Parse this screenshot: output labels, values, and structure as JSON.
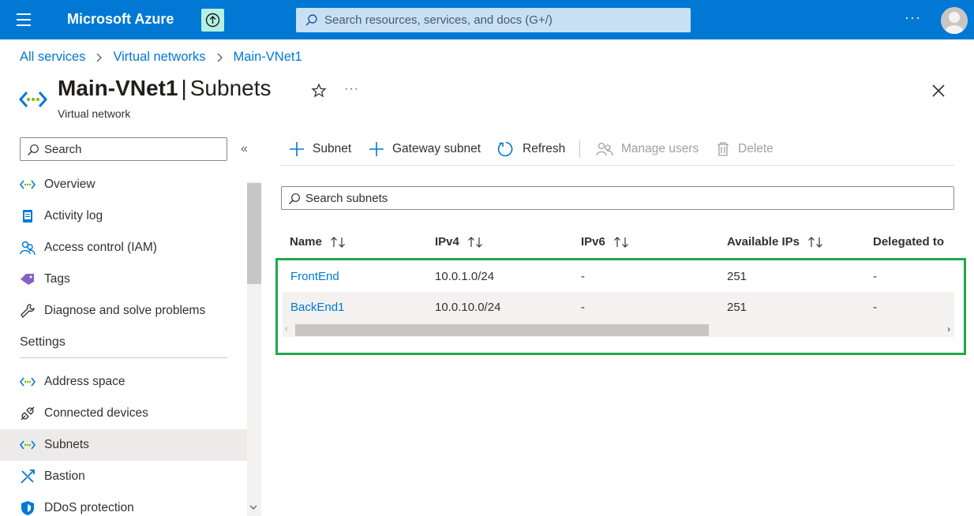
{
  "topbar": {
    "brand": "Microsoft Azure",
    "search_placeholder": "Search resources, services, and docs (G+/)",
    "more": "···",
    "accent": "#0078d4"
  },
  "breadcrumb": [
    "All services",
    "Virtual networks",
    "Main-VNet1"
  ],
  "header": {
    "resource_name": "Main-VNet1",
    "separator": "|",
    "page": "Subnets",
    "subtitle": "Virtual network",
    "more": "···"
  },
  "nav": {
    "search_placeholder": "Search",
    "collapse": "«",
    "items": [
      {
        "label": "Overview",
        "icon": "vnet-icon"
      },
      {
        "label": "Activity log",
        "icon": "log-icon"
      },
      {
        "label": "Access control (IAM)",
        "icon": "people-icon"
      },
      {
        "label": "Tags",
        "icon": "tag-icon"
      },
      {
        "label": "Diagnose and solve problems",
        "icon": "wrench-icon"
      }
    ],
    "section_settings": "Settings",
    "settings_items": [
      {
        "label": "Address space",
        "icon": "vnet-icon"
      },
      {
        "label": "Connected devices",
        "icon": "plug-icon"
      },
      {
        "label": "Subnets",
        "icon": "vnet-icon",
        "active": true
      },
      {
        "label": "Bastion",
        "icon": "bastion-icon"
      },
      {
        "label": "DDoS protection",
        "icon": "shield-icon"
      }
    ]
  },
  "commands": {
    "add_subnet": "Subnet",
    "add_gateway_subnet": "Gateway subnet",
    "refresh": "Refresh",
    "manage_users": "Manage users",
    "delete": "Delete"
  },
  "subnet_search_placeholder": "Search subnets",
  "table": {
    "columns": [
      "Name",
      "IPv4",
      "IPv6",
      "Available IPs",
      "Delegated to"
    ],
    "rows": [
      {
        "name": "FrontEnd",
        "ipv4": "10.0.1.0/24",
        "ipv6": "-",
        "available": "251",
        "delegated": "-"
      },
      {
        "name": "BackEnd1",
        "ipv4": "10.0.10.0/24",
        "ipv6": "-",
        "available": "251",
        "delegated": "-"
      }
    ]
  },
  "highlight_color": "#20a84a"
}
